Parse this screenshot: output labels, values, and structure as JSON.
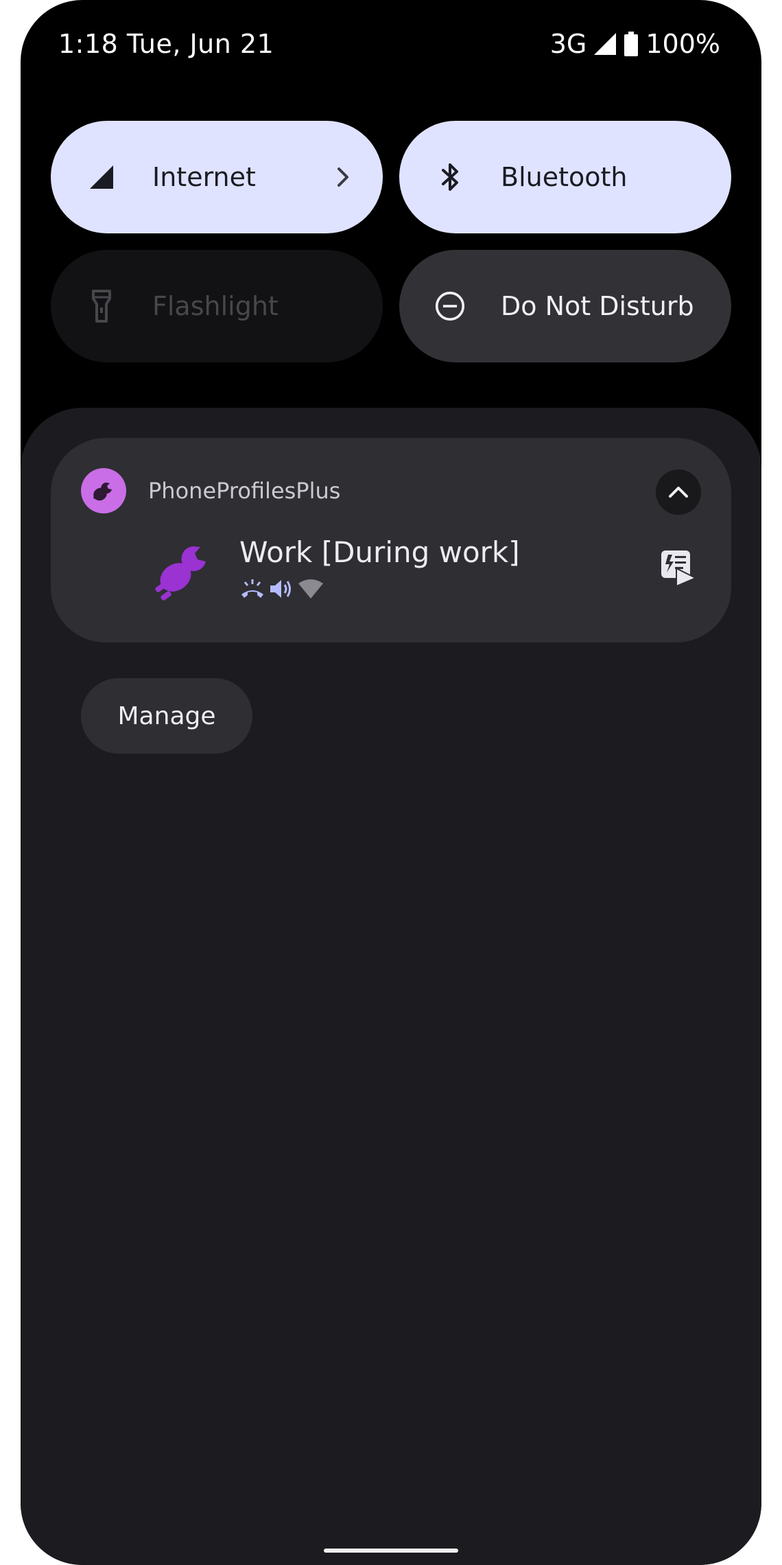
{
  "status_bar": {
    "time_date": "1:18 Tue, Jun 21",
    "network": "3G",
    "battery": "100%"
  },
  "quick_settings": {
    "tiles": [
      {
        "label": "Internet",
        "icon": "signal-icon",
        "state": "on"
      },
      {
        "label": "Bluetooth",
        "icon": "bluetooth-icon",
        "state": "on"
      },
      {
        "label": "Flashlight",
        "icon": "flashlight-icon",
        "state": "unavailable"
      },
      {
        "label": "Do Not Disturb",
        "icon": "do-not-disturb-icon",
        "state": "off"
      }
    ]
  },
  "notification": {
    "app_name": "PhoneProfilesPlus",
    "title": "Work [During work]",
    "sub_icons": [
      "ringer-icon",
      "volume-icon",
      "wifi-icon"
    ],
    "app_icon_color": "#c96ee6",
    "large_icon_color": "#9b32d2"
  },
  "manage_label": "Manage",
  "colors": {
    "tile_on": "#dfe3ff",
    "shade_bg": "#1c1c20",
    "card_bg": "#2e2e33"
  }
}
